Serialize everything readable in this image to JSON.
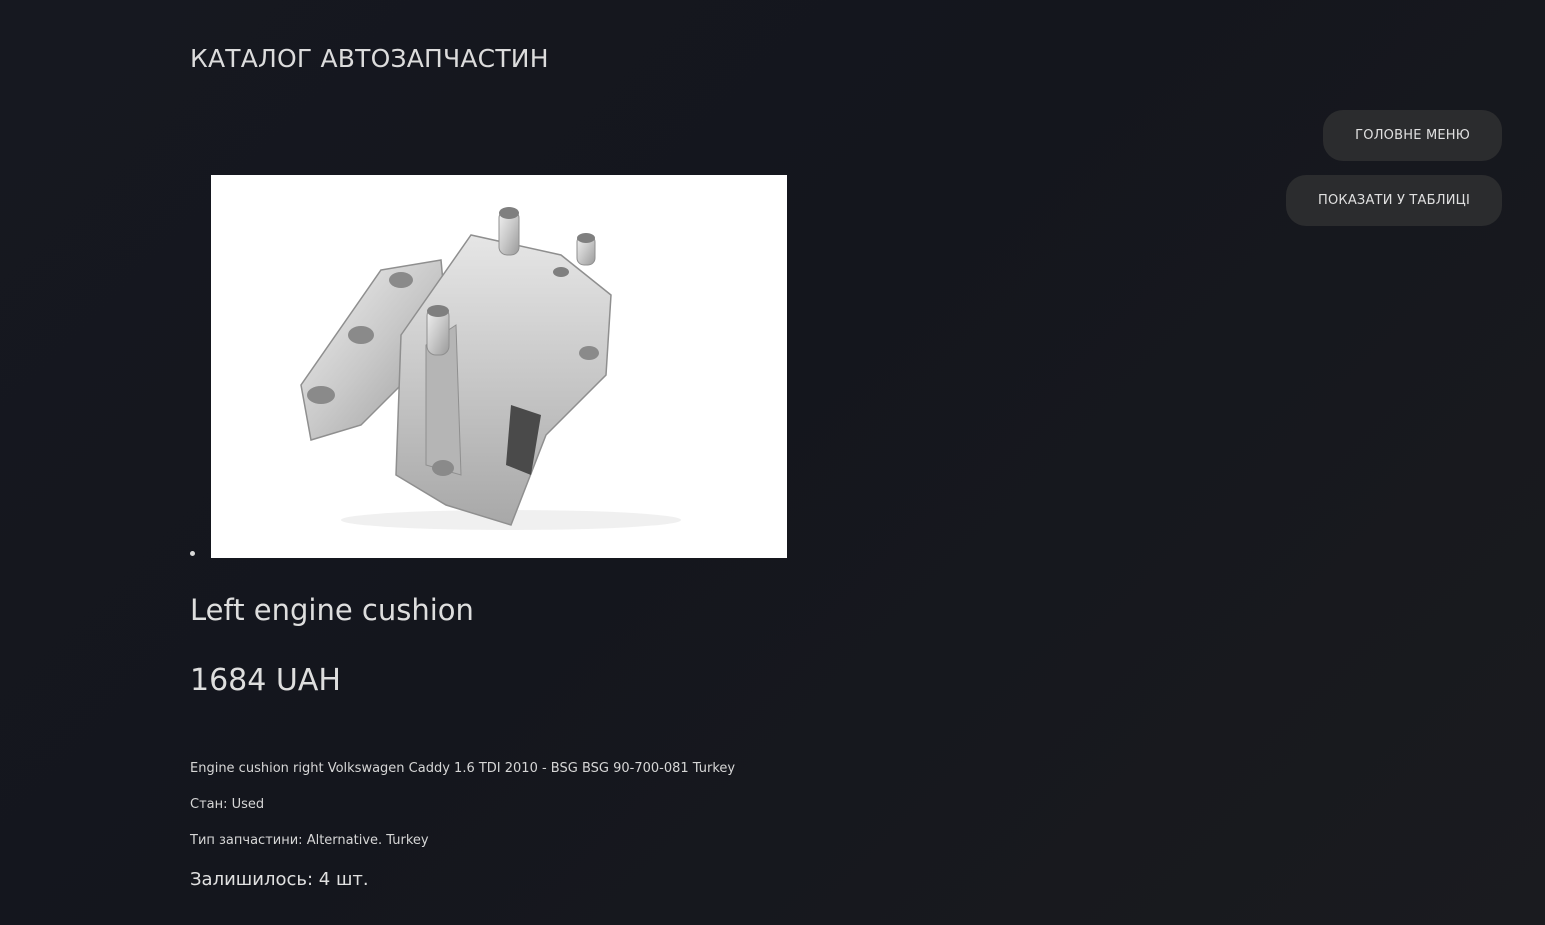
{
  "header": {
    "title": "КАТАЛОГ АВТОЗАПЧАСТИН"
  },
  "nav": {
    "main_menu_label": "ГОЛОВНЕ МЕНЮ",
    "show_table_label": "ПОКАЗАТИ У ТАБЛИЦІ"
  },
  "product": {
    "name": "Left engine cushion",
    "price": "1684 UAH",
    "description": "Engine cushion right Volkswagen Caddy 1.6 TDI 2010 - BSG BSG 90-700-081 Turkey",
    "condition_label": "Стан:",
    "condition_value": "Used",
    "type_label": "Тип запчастини:",
    "type_value": "Alternative. Turkey",
    "stock_label": "Залишилось:",
    "stock_value": "4 шт.",
    "image_icon": "engine-mount-photo"
  },
  "colors": {
    "background": "#161820",
    "button_bg": "#2b2c2e",
    "text": "#d9d9d9"
  }
}
